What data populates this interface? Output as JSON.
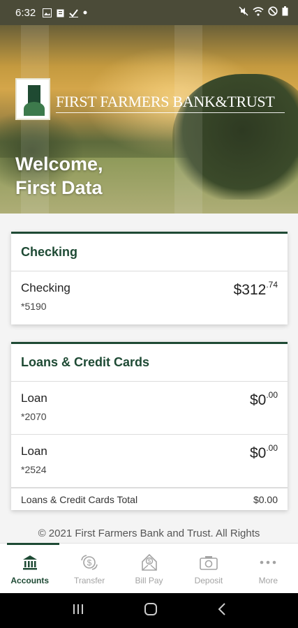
{
  "status_bar": {
    "time": "6:32",
    "icons": [
      "image-icon",
      "clipboard-icon",
      "check-icon",
      "dot-icon",
      "mute-icon",
      "wifi-icon",
      "do-not-disturb-icon",
      "battery-icon"
    ]
  },
  "header": {
    "logo_text": "FIRST FARMERS BANK&TRUST",
    "welcome_line1": "Welcome,",
    "welcome_line2": "First Data"
  },
  "checking_card": {
    "title": "Checking",
    "accounts": [
      {
        "name": "Checking",
        "number": "*5190",
        "balance_whole": "$312",
        "balance_cents": ".74"
      }
    ]
  },
  "loans_card": {
    "title": "Loans & Credit Cards",
    "accounts": [
      {
        "name": "Loan",
        "number": "*2070",
        "balance_whole": "$0",
        "balance_cents": ".00"
      },
      {
        "name": "Loan",
        "number": "*2524",
        "balance_whole": "$0",
        "balance_cents": ".00"
      }
    ],
    "total_label": "Loans & Credit Cards Total",
    "total_value": "$0.00"
  },
  "footer": {
    "copyright": "© 2021 First Farmers Bank and Trust. All Rights"
  },
  "bottom_nav": {
    "items": [
      {
        "label": "Accounts",
        "icon": "bank-icon",
        "active": true
      },
      {
        "label": "Transfer",
        "icon": "transfer-icon",
        "active": false
      },
      {
        "label": "Bill Pay",
        "icon": "bill-pay-icon",
        "active": false
      },
      {
        "label": "Deposit",
        "icon": "camera-icon",
        "active": false
      },
      {
        "label": "More",
        "icon": "more-icon",
        "active": false
      }
    ]
  },
  "colors": {
    "brand_green": "#1e4a34",
    "inactive_gray": "#a3a3a3"
  }
}
